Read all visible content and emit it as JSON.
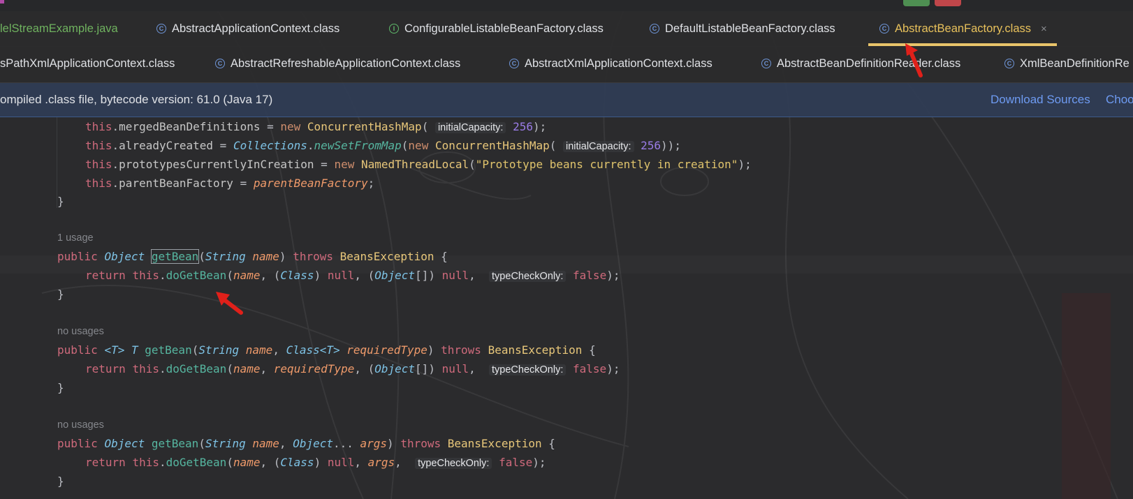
{
  "tabs_row1": [
    {
      "label": "lelStreamExample.java",
      "icon": "java-file-icon",
      "active": false
    },
    {
      "label": "AbstractApplicationContext.class",
      "icon": "class-icon",
      "active": false
    },
    {
      "label": "ConfigurableListableBeanFactory.class",
      "icon": "interface-icon",
      "active": false
    },
    {
      "label": "DefaultListableBeanFactory.class",
      "icon": "class-icon",
      "active": false
    },
    {
      "label": "AbstractBeanFactory.class",
      "icon": "class-icon",
      "active": true
    }
  ],
  "tabs_row2": [
    {
      "label": "sPathXmlApplicationContext.class",
      "icon": "class-icon"
    },
    {
      "label": "AbstractRefreshableApplicationContext.class",
      "icon": "class-icon"
    },
    {
      "label": "AbstractXmlApplicationContext.class",
      "icon": "class-icon"
    },
    {
      "label": "AbstractBeanDefinitionReader.class",
      "icon": "class-icon"
    },
    {
      "label": "XmlBeanDefinitionRe",
      "icon": "class-icon"
    }
  ],
  "banner": {
    "message": "ompiled .class file, bytecode version: 61.0 (Java 17)",
    "download_sources": "Download Sources",
    "choose": "Choo"
  },
  "icons": {
    "class": "C",
    "interface": "I",
    "close": "×"
  },
  "code": {
    "l1_this": "this",
    "l1_field": "mergedBeanDefinitions",
    "l1_new": "new",
    "l1_cls": "ConcurrentHashMap",
    "l1_hint": "initialCapacity:",
    "l1_num": "256",
    "l2_field": "alreadyCreated",
    "l2_cls1": "Collections",
    "l2_fn": "newSetFromMap",
    "l2_cls2": "ConcurrentHashMap",
    "l2_hint": "initialCapacity:",
    "l2_num": "256",
    "l3_field": "prototypesCurrentlyInCreation",
    "l3_cls": "NamedThreadLocal",
    "l3_str": "\"Prototype beans currently in creation\"",
    "l4_field": "parentBeanFactory",
    "l4_param": "parentBeanFactory",
    "usage1": "1 usage",
    "usage2": "no usages",
    "usage3": "no usages",
    "public": "public",
    "return": "return",
    "throws": "throws",
    "null": "null",
    "false": "false",
    "Object": "Object",
    "String": "String",
    "Class": "Class",
    "getBean": "getBean",
    "doGetBean": "doGetBean",
    "name": "name",
    "BeansException": "BeansException",
    "typeCheckOnly": "typeCheckOnly:",
    "T": "T",
    "Tgen": "<T>",
    "ClassT": "Class<T>",
    "requiredType": "requiredType",
    "args": "args"
  }
}
